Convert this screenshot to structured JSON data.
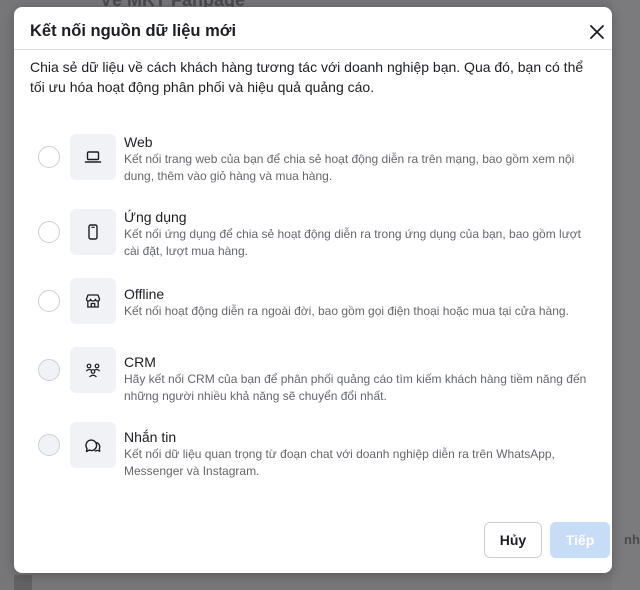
{
  "background": {
    "title_fragment": "Về MKT Fanpage",
    "right_edge_text": "nhà"
  },
  "dialog": {
    "title": "Kết nối nguồn dữ liệu mới",
    "description": "Chia sẻ dữ liệu về cách khách hàng tương tác với doanh nghiệp bạn. Qua đó, bạn có thể tối ưu hóa hoạt động phân phối và hiệu quả quảng cáo.",
    "close_icon": "close-icon",
    "options": [
      {
        "icon": "laptop-icon",
        "title": "Web",
        "desc": "Kết nối trang web của bạn để chia sẻ hoạt động diễn ra trên mạng, bao gồm xem nội dung, thêm vào giỏ hàng và mua hàng.",
        "disabled": false
      },
      {
        "icon": "phone-icon",
        "title": "Ứng dụng",
        "desc": "Kết nối ứng dụng để chia sẻ hoạt động diễn ra trong ứng dụng của bạn, bao gồm lượt cài đặt, lượt mua hàng.",
        "disabled": false
      },
      {
        "icon": "store-icon",
        "title": "Offline",
        "desc": "Kết nối hoạt động diễn ra ngoài đời, bao gồm gọi điện thoại hoặc mua tại cửa hàng.",
        "disabled": false
      },
      {
        "icon": "people-icon",
        "title": "CRM",
        "desc": "Hãy kết nối CRM của bạn để phân phối quảng cáo tìm kiếm khách hàng tiềm năng đến những người nhiều khả năng sẽ chuyển đổi nhất.",
        "disabled": true
      },
      {
        "icon": "chat-icon",
        "title": "Nhắn tin",
        "desc": "Kết nối dữ liệu quan trọng từ đoạn chat với doanh nghiệp diễn ra trên WhatsApp, Messenger và Instagram.",
        "disabled": true
      }
    ],
    "buttons": {
      "cancel": "Hủy",
      "next": "Tiếp"
    }
  }
}
